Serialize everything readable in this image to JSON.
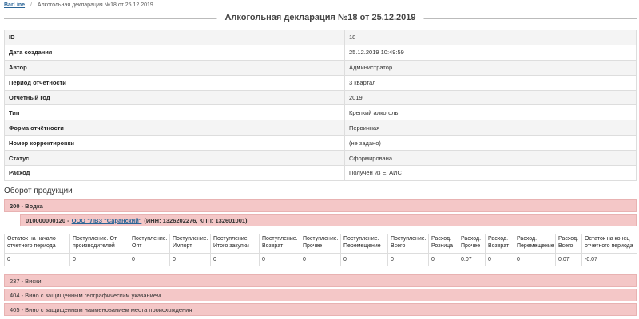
{
  "breadcrumb": {
    "home": "BarLine",
    "separator": "/",
    "current": "Алкогольная декларация №18 от 25.12.2019"
  },
  "page_title": "Алкогольная декларация №18 от 25.12.2019",
  "properties": [
    {
      "label": "ID",
      "value": "18"
    },
    {
      "label": "Дата создания",
      "value": "25.12.2019 10:49:59"
    },
    {
      "label": "Автор",
      "value": "Администратор"
    },
    {
      "label": "Период отчётности",
      "value": "3 квартал"
    },
    {
      "label": "Отчётный год",
      "value": "2019"
    },
    {
      "label": "Тип",
      "value": "Крепкий алкоголь"
    },
    {
      "label": "Форма отчётности",
      "value": "Первичная"
    },
    {
      "label": "Номер корректировки",
      "value": "(не задано)"
    },
    {
      "label": "Статус",
      "value": "Сформирована"
    },
    {
      "label": "Расход",
      "value": "Получен из ЕГАИС"
    }
  ],
  "section_title": "Оборот продукции",
  "groups": {
    "vodka": "200 - Водка",
    "whisky": "237 - Виски",
    "wine_geo": "404 - Вино с защищенным географическим указанием",
    "wine_origin": "405 - Вино с защищенным наименованием места происхождения"
  },
  "manufacturer": {
    "code": "010000000120 -",
    "org": "ООО \"ЛВЗ \"Саранский\"",
    "details": "(ИНН: 1326202276, КПП: 132601001)"
  },
  "turnover": {
    "headers": [
      "Остаток на начало отчетного периода",
      "Поступление. От производителей",
      "Поступление. Опт",
      "Поступление. Импорт",
      "Поступление. Итого закупки",
      "Поступление. Возврат",
      "Поступление. Прочее",
      "Поступление. Перемещение",
      "Поступление. Всего",
      "Расход. Розница",
      "Расход. Прочее",
      "Расход. Возврат",
      "Расход. Перемещение",
      "Расход. Всего",
      "Остаток на конец отчетного периода"
    ],
    "row": [
      "0",
      "0",
      "0",
      "0",
      "0",
      "0",
      "0",
      "0",
      "0",
      "0",
      "0.07",
      "0",
      "0",
      "0.07",
      "-0.07"
    ]
  }
}
